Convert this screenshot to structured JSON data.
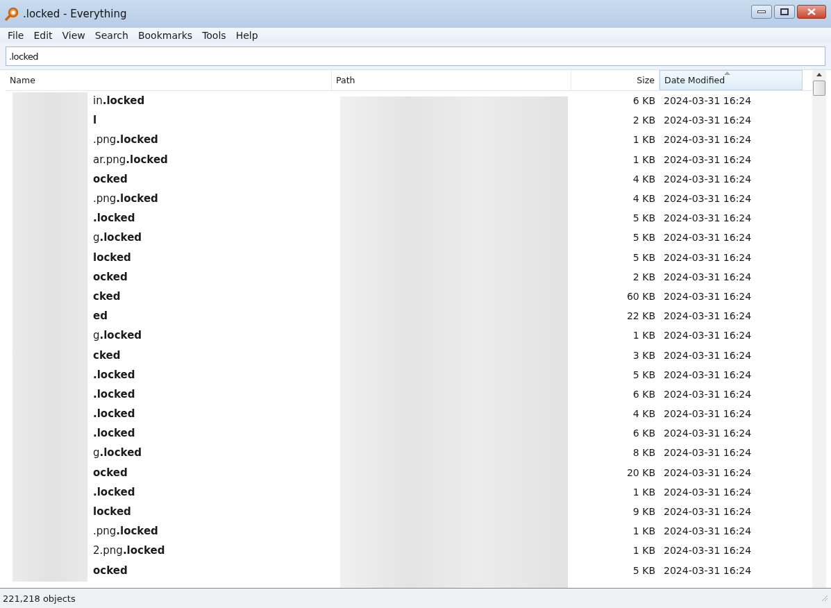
{
  "window": {
    "title": ".locked - Everything"
  },
  "menu": [
    "File",
    "Edit",
    "View",
    "Search",
    "Bookmarks",
    "Tools",
    "Help"
  ],
  "search": {
    "value": ".locked"
  },
  "columns": [
    {
      "label": "Name",
      "sorted": false
    },
    {
      "label": "Path",
      "sorted": false
    },
    {
      "label": "Size",
      "sorted": false
    },
    {
      "label": "Date Modified",
      "sorted": true
    }
  ],
  "rows": [
    {
      "stem": "in",
      "ext": ".locked",
      "size": "6 KB",
      "modified": "2024-03-31 16:24"
    },
    {
      "stem": "",
      "ext": "l",
      "size": "2 KB",
      "modified": "2024-03-31 16:24"
    },
    {
      "stem": ".png",
      "ext": ".locked",
      "size": "1 KB",
      "modified": "2024-03-31 16:24"
    },
    {
      "stem": "ar.png",
      "ext": ".locked",
      "size": "1 KB",
      "modified": "2024-03-31 16:24"
    },
    {
      "stem": "",
      "ext": "ocked",
      "size": "4 KB",
      "modified": "2024-03-31 16:24"
    },
    {
      "stem": ".png",
      "ext": ".locked",
      "size": "4 KB",
      "modified": "2024-03-31 16:24"
    },
    {
      "stem": "",
      "ext": ".locked",
      "size": "5 KB",
      "modified": "2024-03-31 16:24"
    },
    {
      "stem": "g",
      "ext": ".locked",
      "size": "5 KB",
      "modified": "2024-03-31 16:24"
    },
    {
      "stem": "",
      "ext": "locked",
      "size": "5 KB",
      "modified": "2024-03-31 16:24"
    },
    {
      "stem": "",
      "ext": "ocked",
      "size": "2 KB",
      "modified": "2024-03-31 16:24"
    },
    {
      "stem": "",
      "ext": "cked",
      "size": "60 KB",
      "modified": "2024-03-31 16:24"
    },
    {
      "stem": "",
      "ext": "ed",
      "size": "22 KB",
      "modified": "2024-03-31 16:24"
    },
    {
      "stem": "g",
      "ext": ".locked",
      "size": "1 KB",
      "modified": "2024-03-31 16:24"
    },
    {
      "stem": "",
      "ext": "cked",
      "size": "3 KB",
      "modified": "2024-03-31 16:24"
    },
    {
      "stem": "",
      "ext": ".locked",
      "size": "5 KB",
      "modified": "2024-03-31 16:24"
    },
    {
      "stem": "",
      "ext": ".locked",
      "size": "6 KB",
      "modified": "2024-03-31 16:24"
    },
    {
      "stem": "",
      "ext": ".locked",
      "size": "4 KB",
      "modified": "2024-03-31 16:24"
    },
    {
      "stem": "",
      "ext": ".locked",
      "size": "6 KB",
      "modified": "2024-03-31 16:24"
    },
    {
      "stem": "g",
      "ext": ".locked",
      "size": "8 KB",
      "modified": "2024-03-31 16:24"
    },
    {
      "stem": "",
      "ext": "ocked",
      "size": "20 KB",
      "modified": "2024-03-31 16:24"
    },
    {
      "stem": "",
      "ext": ".locked",
      "size": "1 KB",
      "modified": "2024-03-31 16:24"
    },
    {
      "stem": "",
      "ext": "locked",
      "size": "9 KB",
      "modified": "2024-03-31 16:24"
    },
    {
      "stem": ".png",
      "ext": ".locked",
      "size": "1 KB",
      "modified": "2024-03-31 16:24"
    },
    {
      "stem": "2.png",
      "ext": ".locked",
      "size": "1 KB",
      "modified": "2024-03-31 16:24"
    },
    {
      "stem": "",
      "ext": "ocked",
      "size": "5 KB",
      "modified": "2024-03-31 16:24"
    }
  ],
  "status_bar": {
    "text": "221,218 objects"
  }
}
